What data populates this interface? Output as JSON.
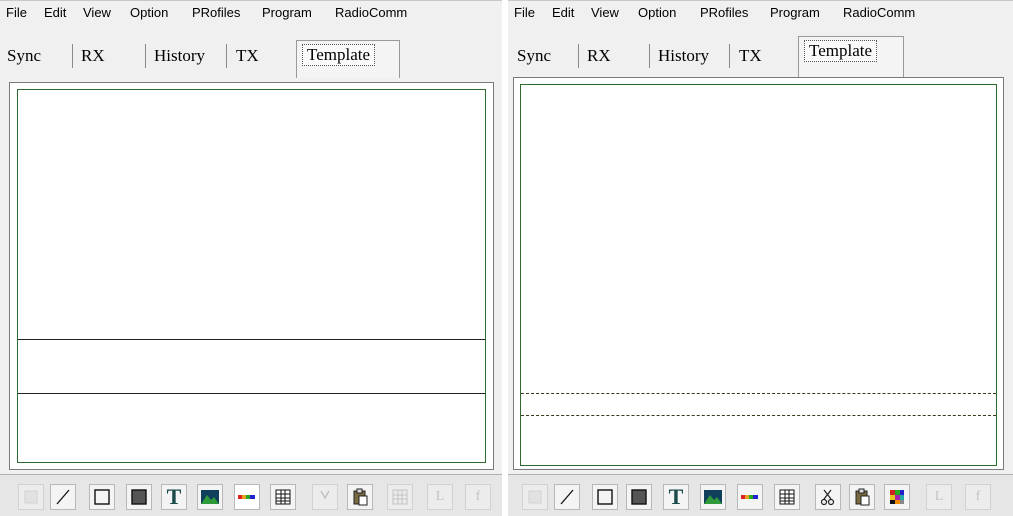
{
  "left": {
    "menu": [
      "File",
      "Edit",
      "View",
      "Option",
      "PRofiles",
      "Program",
      "RadioComm"
    ],
    "tabs": [
      "Sync",
      "RX",
      "History",
      "TX",
      "Template"
    ],
    "tools": [
      {
        "name": "eraser-tool-icon",
        "enabled": false
      },
      {
        "name": "line-tool-icon",
        "enabled": true
      },
      {
        "name": "rectangle-tool-icon",
        "enabled": true
      },
      {
        "name": "filled-rectangle-tool-icon",
        "enabled": true
      },
      {
        "name": "text-tool-icon",
        "enabled": true,
        "glyph": "T"
      },
      {
        "name": "image-tool-icon",
        "enabled": true
      },
      {
        "name": "color-bar-tool-icon",
        "enabled": true
      },
      {
        "name": "grid-tool-icon",
        "enabled": true
      },
      {
        "name": "cut-tool-icon",
        "enabled": false
      },
      {
        "name": "paste-tool-icon",
        "enabled": true
      },
      {
        "name": "color-grid-tool-icon",
        "enabled": false
      },
      {
        "name": "l-tool",
        "enabled": false,
        "glyph": "L"
      },
      {
        "name": "f-tool",
        "enabled": false,
        "glyph": "f"
      }
    ]
  },
  "right": {
    "menu": [
      "File",
      "Edit",
      "View",
      "Option",
      "PRofiles",
      "Program",
      "RadioComm"
    ],
    "tabs": [
      "Sync",
      "RX",
      "History",
      "TX",
      "Template"
    ],
    "tools": [
      {
        "name": "eraser-tool-icon",
        "enabled": false
      },
      {
        "name": "line-tool-icon",
        "enabled": true
      },
      {
        "name": "rectangle-tool-icon",
        "enabled": true
      },
      {
        "name": "filled-rectangle-tool-icon",
        "enabled": true
      },
      {
        "name": "text-tool-icon",
        "enabled": true,
        "glyph": "T"
      },
      {
        "name": "image-tool-icon",
        "enabled": true
      },
      {
        "name": "color-bar-tool-icon",
        "enabled": true
      },
      {
        "name": "grid-tool-icon",
        "enabled": true
      },
      {
        "name": "cut-tool-icon",
        "enabled": true
      },
      {
        "name": "paste-tool-icon",
        "enabled": true
      },
      {
        "name": "color-grid-tool-icon",
        "enabled": true
      },
      {
        "name": "l-tool",
        "enabled": false,
        "glyph": "L"
      },
      {
        "name": "f-tool",
        "enabled": false,
        "glyph": "f"
      }
    ]
  },
  "colors": {
    "canvas_border": "#2e6b2e",
    "divider_solid": "#222222",
    "divider_dashed": "#3a3a1a",
    "text_tool": "#1a4a4a",
    "image_green": "#2e9a3a"
  }
}
